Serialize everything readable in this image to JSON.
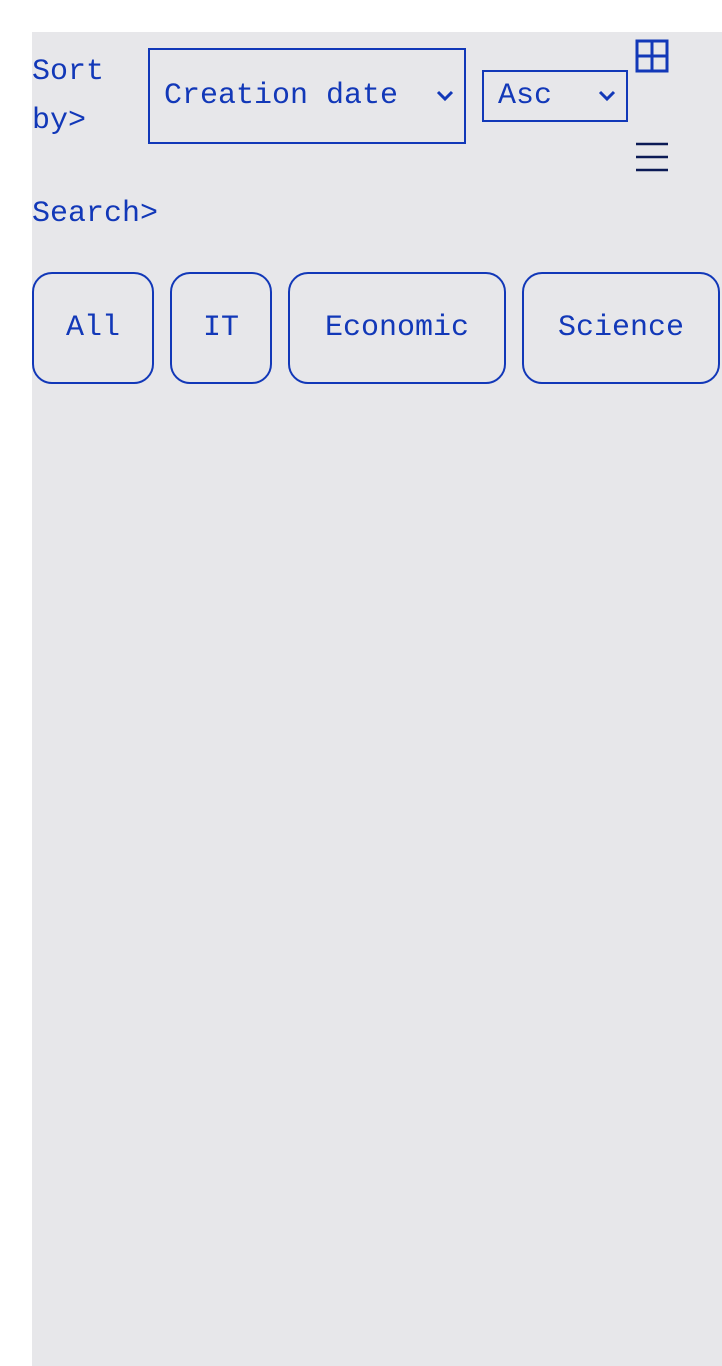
{
  "sort": {
    "label": "Sort by>",
    "field_selected": "Creation date",
    "order_selected": "Asc"
  },
  "search": {
    "label": "Search>"
  },
  "categories": [
    "All",
    "IT",
    "Economic",
    "Science"
  ],
  "view_icons": [
    "grid-view-icon",
    "list-view-icon"
  ],
  "colors": {
    "accent": "#1238b8",
    "panel_bg": "#e7e7ea",
    "page_bg": "#ffffff"
  }
}
